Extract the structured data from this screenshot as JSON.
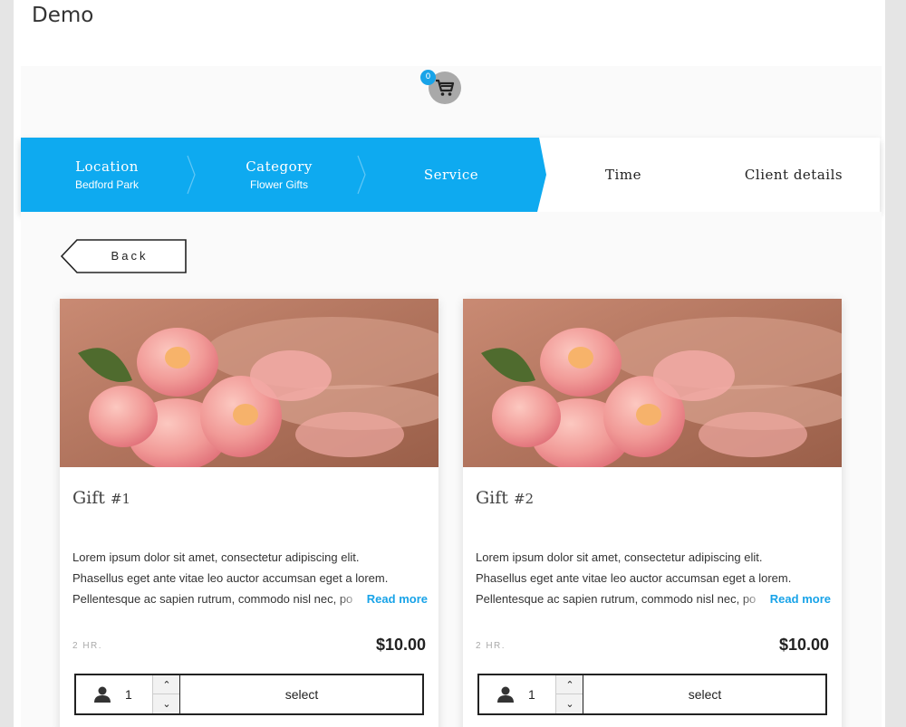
{
  "header": {
    "title": "Demo"
  },
  "cart": {
    "count": "0",
    "icon": "cart-icon"
  },
  "steps": [
    {
      "label": "Location",
      "value": "Bedford Park",
      "state": "done"
    },
    {
      "label": "Category",
      "value": "Flower Gifts",
      "state": "done"
    },
    {
      "label": "Service",
      "value": "",
      "state": "current"
    },
    {
      "label": "Time",
      "value": "",
      "state": "upcoming"
    },
    {
      "label": "Client details",
      "value": "",
      "state": "upcoming"
    }
  ],
  "back_label": "Back",
  "services": [
    {
      "title": "Gift",
      "number": "#1",
      "description": [
        "Lorem ipsum dolor sit amet, consectetur adipiscing elit.",
        "Phasellus eget ante vitae leo auctor accumsan eget a lorem.",
        "Pellentesque ac sapien rutrum, commodo nisl nec, po"
      ],
      "read_more": "Read more",
      "duration": "2 HR.",
      "price": "$10.00",
      "quantity": "1",
      "select_label": "select"
    },
    {
      "title": "Gift",
      "number": "#2",
      "description": [
        "Lorem ipsum dolor sit amet, consectetur adipiscing elit.",
        "Phasellus eget ante vitae leo auctor accumsan eget a lorem.",
        "Pellentesque ac sapien rutrum, commodo nisl nec, po"
      ],
      "read_more": "Read more",
      "duration": "2 HR.",
      "price": "$10.00",
      "quantity": "1",
      "select_label": "select"
    }
  ],
  "colors": {
    "accent": "#18a3e8",
    "step_active_bg": "#0eaaf0",
    "cart_bg": "#a9a9a9"
  }
}
